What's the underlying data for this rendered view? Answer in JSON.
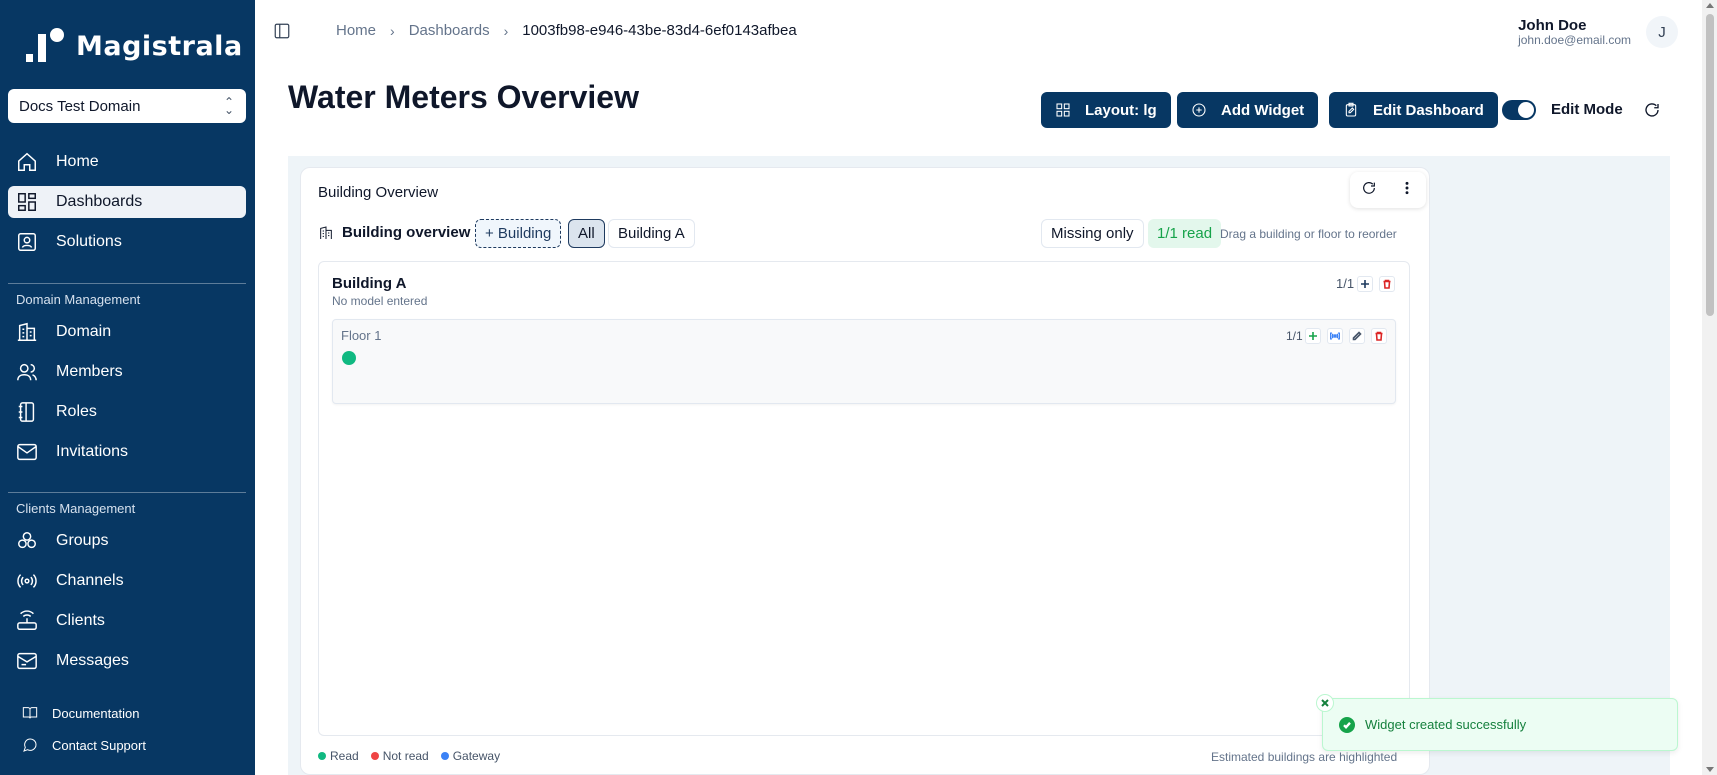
{
  "app": {
    "name": "Magistrala"
  },
  "domain_select": {
    "value": "Docs Test Domain"
  },
  "sidebar": {
    "main_items": [
      {
        "label": "Home",
        "icon": "home-icon"
      },
      {
        "label": "Dashboards",
        "icon": "dashboard-icon",
        "active": true
      },
      {
        "label": "Solutions",
        "icon": "solutions-icon"
      }
    ],
    "domain_group": "Domain Management",
    "domain_items": [
      {
        "label": "Domain",
        "icon": "building-icon"
      },
      {
        "label": "Members",
        "icon": "users-icon"
      },
      {
        "label": "Roles",
        "icon": "roles-icon"
      },
      {
        "label": "Invitations",
        "icon": "mail-icon"
      }
    ],
    "clients_group": "Clients Management",
    "clients_items": [
      {
        "label": "Groups",
        "icon": "groups-icon"
      },
      {
        "label": "Channels",
        "icon": "radio-icon"
      },
      {
        "label": "Clients",
        "icon": "router-icon"
      },
      {
        "label": "Messages",
        "icon": "messages-icon"
      }
    ],
    "footer_items": [
      {
        "label": "Documentation",
        "icon": "book-icon"
      },
      {
        "label": "Contact Support",
        "icon": "chat-icon"
      }
    ]
  },
  "breadcrumb": {
    "home": "Home",
    "dashboards": "Dashboards",
    "current": "1003fb98-e946-43be-83d4-6ef0143afbea"
  },
  "user": {
    "name": "John Doe",
    "email": "john.doe@email.com",
    "initial": "J"
  },
  "page": {
    "title": "Water Meters Overview"
  },
  "toolbar": {
    "layout_label": "Layout: lg",
    "add_widget_label": "Add Widget",
    "edit_dashboard_label": "Edit Dashboard",
    "edit_mode_label": "Edit Mode",
    "edit_mode_on": true
  },
  "widget": {
    "title": "Building Overview",
    "overview_label": "Building overview",
    "add_building": "+ Building",
    "filter_all": "All",
    "filter_building": "Building A",
    "missing_only": "Missing only",
    "read_status": "1/1 read",
    "drag_hint": "Drag a building or floor to reorder",
    "building": {
      "name": "Building A",
      "model": "No model entered",
      "count": "1/1",
      "floor": {
        "name": "Floor 1",
        "count": "1/1"
      }
    },
    "legend": [
      {
        "label": "Read",
        "color": "#10b981"
      },
      {
        "label": "Not read",
        "color": "#ef4444"
      },
      {
        "label": "Gateway",
        "color": "#3b82f6"
      }
    ],
    "estimated_note": "Estimated buildings are highlighted"
  },
  "toast": {
    "message": "Widget created successfully"
  },
  "colors": {
    "sidebar": "#073763",
    "primary": "#073763",
    "success": "#16a34a"
  }
}
